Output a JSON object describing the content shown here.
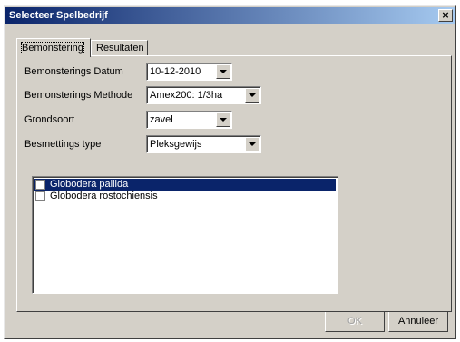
{
  "window": {
    "title": "Selecteer Spelbedrijf",
    "close_glyph": "×"
  },
  "tabs": [
    {
      "label": "Bemonstering",
      "active": true
    },
    {
      "label": "Resultaten",
      "active": false
    }
  ],
  "form": {
    "datum": {
      "label": "Bemonsterings Datum",
      "value": "10-12-2010"
    },
    "methode": {
      "label": "Bemonsterings Methode",
      "value": "Amex200: 1/3ha"
    },
    "grondsoort": {
      "label": "Grondsoort",
      "value": "zavel"
    },
    "besmetting": {
      "label": "Besmettings type",
      "value": "Pleksgewijs"
    }
  },
  "species_list": [
    {
      "label": "Globodera pallida",
      "checked": false,
      "selected": true
    },
    {
      "label": "Globodera rostochiensis",
      "checked": false,
      "selected": false
    }
  ],
  "buttons": {
    "ok": {
      "label": "OK",
      "enabled": false
    },
    "cancel": {
      "label": "Annuleer",
      "enabled": true
    }
  },
  "colors": {
    "titlebar_start": "#0a246a",
    "titlebar_end": "#a6caf0",
    "selection": "#0a246a",
    "face": "#d4d0c8"
  },
  "icons": {
    "close": "close-icon",
    "dropdown": "chevron-down-icon",
    "checkbox": "checkbox-icon"
  }
}
